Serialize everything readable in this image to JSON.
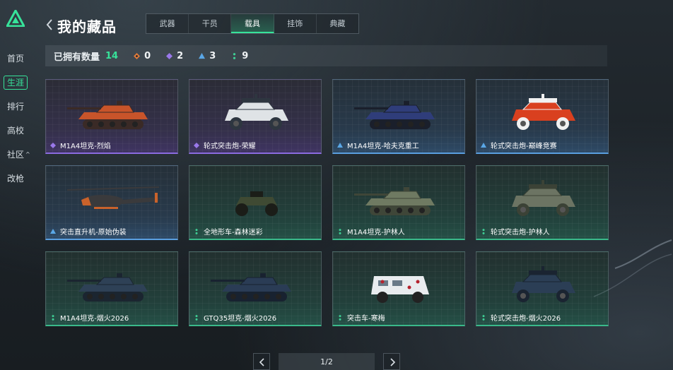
{
  "nav": {
    "items": [
      {
        "label": "首页",
        "active": false
      },
      {
        "label": "生涯",
        "active": true
      },
      {
        "label": "排行",
        "active": false
      },
      {
        "label": "高校",
        "active": false
      },
      {
        "label": "社区",
        "active": false,
        "caret": "^"
      },
      {
        "label": "改枪",
        "active": false
      }
    ]
  },
  "header": {
    "title": "我的藏品",
    "tabs": [
      {
        "label": "武器",
        "active": false
      },
      {
        "label": "干员",
        "active": false
      },
      {
        "label": "载具",
        "active": true
      },
      {
        "label": "挂饰",
        "active": false
      },
      {
        "label": "典藏",
        "active": false
      }
    ]
  },
  "summary": {
    "owned_label": "已拥有数量",
    "owned_count": "14",
    "rarities": [
      {
        "icon": "orange-diamond-icon",
        "color": "#e07a3a",
        "count": "0"
      },
      {
        "icon": "purple-diamond-icon",
        "color": "#9a78ea",
        "count": "2"
      },
      {
        "icon": "blue-triangle-icon",
        "color": "#5aa7e6",
        "count": "3"
      },
      {
        "icon": "green-dots-icon",
        "color": "#3fcf95",
        "count": "9"
      }
    ]
  },
  "items": [
    {
      "name": "M1A4坦克-烈焰",
      "rarity": "purple",
      "vehicle": "tank",
      "colors": [
        "#c8542a",
        "#3a2a26"
      ]
    },
    {
      "name": "轮式突击炮-荣耀",
      "rarity": "purple",
      "vehicle": "wheeled",
      "colors": [
        "#dfe3e6",
        "#2e3640"
      ]
    },
    {
      "name": "M1A4坦克-哈夫克重工",
      "rarity": "blue",
      "vehicle": "tank",
      "colors": [
        "#2f3d7a",
        "#1a1f2b"
      ]
    },
    {
      "name": "轮式突击炮-巅峰竞赛",
      "rarity": "blue",
      "vehicle": "wheeled",
      "colors": [
        "#d9401f",
        "#f1f1f1"
      ]
    },
    {
      "name": "突击直升机-原始伪装",
      "rarity": "blue",
      "vehicle": "helicopter",
      "colors": [
        "#3a3a3c",
        "#c9622b"
      ]
    },
    {
      "name": "全地形车-森林迷彩",
      "rarity": "green",
      "vehicle": "atv",
      "colors": [
        "#3f4a33",
        "#1b1d18"
      ]
    },
    {
      "name": "M1A4坦克-护林人",
      "rarity": "green",
      "vehicle": "tank",
      "colors": [
        "#6f7a62",
        "#3f4638"
      ]
    },
    {
      "name": "轮式突击炮-护林人",
      "rarity": "green",
      "vehicle": "wheeled",
      "colors": [
        "#6c7463",
        "#3b4236"
      ]
    },
    {
      "name": "M1A4坦克-烟火2026",
      "rarity": "green",
      "vehicle": "tank",
      "colors": [
        "#2e4156",
        "#1b2530"
      ]
    },
    {
      "name": "GTQ35坦克-烟火2026",
      "rarity": "green",
      "vehicle": "tank",
      "colors": [
        "#2a3c55",
        "#182230"
      ]
    },
    {
      "name": "突击车-寒梅",
      "rarity": "green",
      "vehicle": "truck",
      "colors": [
        "#e9ecef",
        "#b5232e"
      ]
    },
    {
      "name": "轮式突击炮-烟火2026",
      "rarity": "green",
      "vehicle": "wheeled",
      "colors": [
        "#2b3e55",
        "#1a2431"
      ]
    }
  ],
  "pager": {
    "page": "1/2"
  }
}
